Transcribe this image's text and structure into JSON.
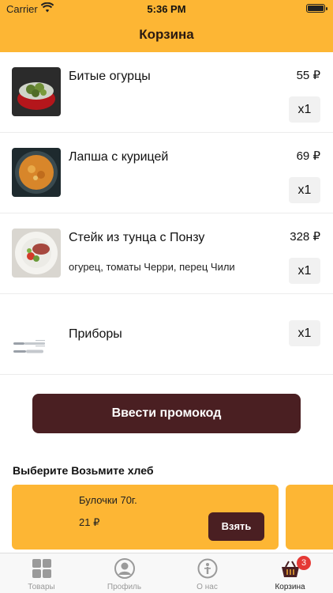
{
  "status_bar": {
    "carrier": "Carrier",
    "time": "5:36 PM"
  },
  "header": {
    "title": "Корзина"
  },
  "cart": {
    "items": [
      {
        "name": "Битые огурцы",
        "description": "",
        "price": "55 ₽",
        "quantity": "x1"
      },
      {
        "name": "Лапша с курицей",
        "description": "",
        "price": "69 ₽",
        "quantity": "x1"
      },
      {
        "name": "Стейк из тунца с Понзу",
        "description": "огурец, томаты Черри, перец Чили",
        "price": "328 ₽",
        "quantity": "x1"
      },
      {
        "name": "Приборы",
        "description": "",
        "price": "",
        "quantity": "x1"
      }
    ]
  },
  "promo_button": "Ввести промокод",
  "bread_section": {
    "title": "Выберите Возьмите хлеб",
    "cards": [
      {
        "name": "Булочки 70г.",
        "price": "21 ₽",
        "action": "Взять"
      }
    ]
  },
  "tab_bar": {
    "tabs": [
      {
        "label": "Товары",
        "icon": "grid-icon"
      },
      {
        "label": "Профиль",
        "icon": "profile-icon"
      },
      {
        "label": "О нас",
        "icon": "info-icon"
      },
      {
        "label": "Корзина",
        "icon": "basket-icon",
        "badge": "3"
      }
    ]
  },
  "colors": {
    "accent": "#fdb634",
    "brand_dark": "#4a1f22",
    "badge": "#e53935"
  }
}
